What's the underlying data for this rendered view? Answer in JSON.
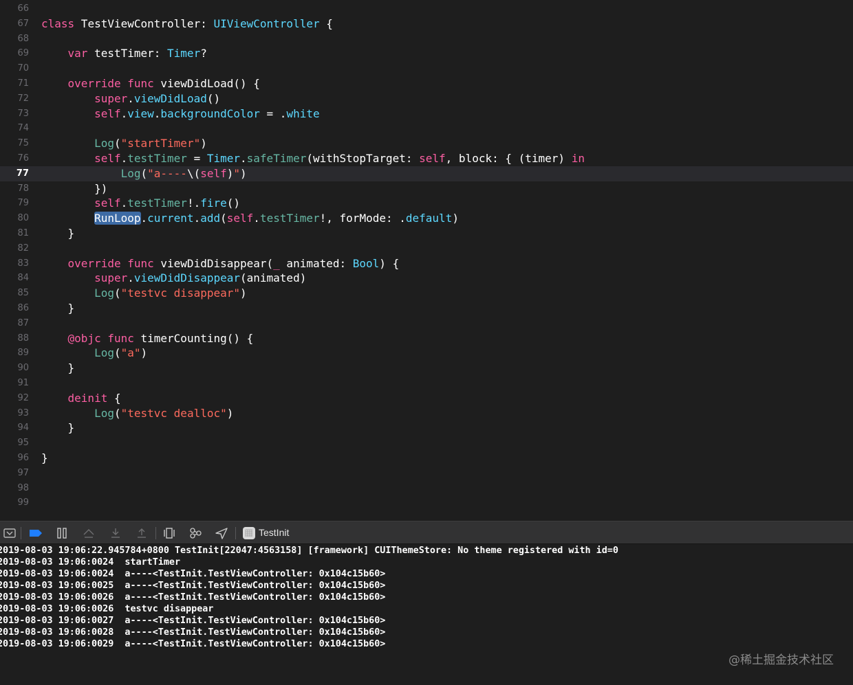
{
  "colors": {
    "keyword": "#fc5fa3",
    "type": "#5dd8ff",
    "function": "#67b7a4",
    "string": "#fc6a5d",
    "plain": "#ffffff",
    "selection": "#3d6ba5",
    "editor_bg": "#1e1e1e",
    "line_number": "#6b6b70",
    "debug_bar_bg": "#323233"
  },
  "editor": {
    "current_line": "77",
    "lines": [
      {
        "n": "66",
        "tokens": []
      },
      {
        "n": "67",
        "tokens": [
          [
            "kw",
            "class"
          ],
          [
            "p",
            " TestViewController: "
          ],
          [
            "type",
            "UIViewController"
          ],
          [
            "p",
            " {"
          ]
        ]
      },
      {
        "n": "68",
        "tokens": []
      },
      {
        "n": "69",
        "tokens": [
          [
            "p",
            "    "
          ],
          [
            "kw",
            "var"
          ],
          [
            "p",
            " testTimer: "
          ],
          [
            "type",
            "Timer"
          ],
          [
            "p",
            "?"
          ]
        ]
      },
      {
        "n": "70",
        "tokens": []
      },
      {
        "n": "71",
        "tokens": [
          [
            "p",
            "    "
          ],
          [
            "kw",
            "override"
          ],
          [
            "p",
            " "
          ],
          [
            "kw",
            "func"
          ],
          [
            "p",
            " viewDidLoad() {"
          ]
        ]
      },
      {
        "n": "72",
        "tokens": [
          [
            "p",
            "        "
          ],
          [
            "kw",
            "super"
          ],
          [
            "p",
            "."
          ],
          [
            "type",
            "viewDidLoad"
          ],
          [
            "p",
            "()"
          ]
        ]
      },
      {
        "n": "73",
        "tokens": [
          [
            "p",
            "        "
          ],
          [
            "kw",
            "self"
          ],
          [
            "p",
            "."
          ],
          [
            "type",
            "view"
          ],
          [
            "p",
            "."
          ],
          [
            "type",
            "backgroundColor"
          ],
          [
            "p",
            " = ."
          ],
          [
            "type",
            "white"
          ]
        ]
      },
      {
        "n": "74",
        "tokens": []
      },
      {
        "n": "75",
        "tokens": [
          [
            "p",
            "        "
          ],
          [
            "fn",
            "Log"
          ],
          [
            "p",
            "("
          ],
          [
            "str",
            "\"startTimer\""
          ],
          [
            "p",
            ")"
          ]
        ]
      },
      {
        "n": "76",
        "tokens": [
          [
            "p",
            "        "
          ],
          [
            "kw",
            "self"
          ],
          [
            "p",
            "."
          ],
          [
            "fn",
            "testTimer"
          ],
          [
            "p",
            " = "
          ],
          [
            "type",
            "Timer"
          ],
          [
            "p",
            "."
          ],
          [
            "fn",
            "safeTimer"
          ],
          [
            "p",
            "(withStopTarget: "
          ],
          [
            "kw",
            "self"
          ],
          [
            "p",
            ", block: { (timer) "
          ],
          [
            "kw",
            "in"
          ]
        ]
      },
      {
        "n": "77",
        "tokens": [
          [
            "p",
            "            "
          ],
          [
            "fn",
            "Log"
          ],
          [
            "p",
            "("
          ],
          [
            "str",
            "\"a----"
          ],
          [
            "p",
            "\\("
          ],
          [
            "kw",
            "self"
          ],
          [
            "p",
            ")"
          ],
          [
            "str",
            "\""
          ],
          [
            "p",
            ")"
          ]
        ]
      },
      {
        "n": "78",
        "tokens": [
          [
            "p",
            "        })"
          ]
        ]
      },
      {
        "n": "79",
        "tokens": [
          [
            "p",
            "        "
          ],
          [
            "kw",
            "self"
          ],
          [
            "p",
            "."
          ],
          [
            "fn",
            "testTimer"
          ],
          [
            "p",
            "!."
          ],
          [
            "type",
            "fire"
          ],
          [
            "p",
            "()"
          ]
        ]
      },
      {
        "n": "80",
        "tokens": [
          [
            "p",
            "        "
          ],
          [
            "sel",
            "RunLoop"
          ],
          [
            "p",
            "."
          ],
          [
            "type",
            "current"
          ],
          [
            "p",
            "."
          ],
          [
            "type",
            "add"
          ],
          [
            "p",
            "("
          ],
          [
            "kw",
            "self"
          ],
          [
            "p",
            "."
          ],
          [
            "fn",
            "testTimer"
          ],
          [
            "p",
            "!, forMode: ."
          ],
          [
            "type",
            "default"
          ],
          [
            "p",
            ")"
          ]
        ]
      },
      {
        "n": "81",
        "tokens": [
          [
            "p",
            "    }"
          ]
        ]
      },
      {
        "n": "82",
        "tokens": []
      },
      {
        "n": "83",
        "tokens": [
          [
            "p",
            "    "
          ],
          [
            "kw",
            "override"
          ],
          [
            "p",
            " "
          ],
          [
            "kw",
            "func"
          ],
          [
            "p",
            " viewDidDisappear("
          ],
          [
            "kw",
            "_"
          ],
          [
            "p",
            " animated: "
          ],
          [
            "type",
            "Bool"
          ],
          [
            "p",
            ") {"
          ]
        ]
      },
      {
        "n": "84",
        "tokens": [
          [
            "p",
            "        "
          ],
          [
            "kw",
            "super"
          ],
          [
            "p",
            "."
          ],
          [
            "type",
            "viewDidDisappear"
          ],
          [
            "p",
            "(animated)"
          ]
        ]
      },
      {
        "n": "85",
        "tokens": [
          [
            "p",
            "        "
          ],
          [
            "fn",
            "Log"
          ],
          [
            "p",
            "("
          ],
          [
            "str",
            "\"testvc disappear\""
          ],
          [
            "p",
            ")"
          ]
        ]
      },
      {
        "n": "86",
        "tokens": [
          [
            "p",
            "    }"
          ]
        ]
      },
      {
        "n": "87",
        "tokens": []
      },
      {
        "n": "88",
        "tokens": [
          [
            "p",
            "    "
          ],
          [
            "kw",
            "@objc"
          ],
          [
            "p",
            " "
          ],
          [
            "kw",
            "func"
          ],
          [
            "p",
            " timerCounting() {"
          ]
        ]
      },
      {
        "n": "89",
        "tokens": [
          [
            "p",
            "        "
          ],
          [
            "fn",
            "Log"
          ],
          [
            "p",
            "("
          ],
          [
            "str",
            "\"a\""
          ],
          [
            "p",
            ")"
          ]
        ]
      },
      {
        "n": "90",
        "tokens": [
          [
            "p",
            "    }"
          ]
        ]
      },
      {
        "n": "91",
        "tokens": []
      },
      {
        "n": "92",
        "tokens": [
          [
            "p",
            "    "
          ],
          [
            "kw",
            "deinit"
          ],
          [
            "p",
            " {"
          ]
        ]
      },
      {
        "n": "93",
        "tokens": [
          [
            "p",
            "        "
          ],
          [
            "fn",
            "Log"
          ],
          [
            "p",
            "("
          ],
          [
            "str",
            "\"testvc dealloc\""
          ],
          [
            "p",
            ")"
          ]
        ]
      },
      {
        "n": "94",
        "tokens": [
          [
            "p",
            "    }"
          ]
        ]
      },
      {
        "n": "95",
        "tokens": []
      },
      {
        "n": "96",
        "tokens": [
          [
            "p",
            "}"
          ]
        ]
      },
      {
        "n": "97",
        "tokens": []
      },
      {
        "n": "98",
        "tokens": []
      },
      {
        "n": "99",
        "tokens": []
      }
    ]
  },
  "debug_bar": {
    "buttons": [
      {
        "name": "hide-console-button",
        "icon": "console-toggle-icon"
      },
      {
        "name": "breakpoints-toggle-button",
        "icon": "breakpoint-icon"
      },
      {
        "name": "pause-button",
        "icon": "pause-icon"
      },
      {
        "name": "step-over-button",
        "icon": "step-over-icon"
      },
      {
        "name": "step-into-button",
        "icon": "step-into-icon"
      },
      {
        "name": "step-out-button",
        "icon": "step-out-icon"
      },
      {
        "name": "view-debugger-button",
        "icon": "view-hierarchy-icon"
      },
      {
        "name": "memory-graph-button",
        "icon": "memory-graph-icon"
      },
      {
        "name": "simulate-location-button",
        "icon": "location-arrow-icon"
      }
    ],
    "target_name": "TestInit"
  },
  "console": {
    "lines": [
      "2019-08-03 19:06:22.945784+0800 TestInit[22047:4563158] [framework] CUIThemeStore: No theme registered with id=0",
      "2019-08-03 19:06:0024  startTimer",
      "2019-08-03 19:06:0024  a----<TestInit.TestViewController: 0x104c15b60>",
      "2019-08-03 19:06:0025  a----<TestInit.TestViewController: 0x104c15b60>",
      "2019-08-03 19:06:0026  a----<TestInit.TestViewController: 0x104c15b60>",
      "2019-08-03 19:06:0026  testvc disappear",
      "2019-08-03 19:06:0027  a----<TestInit.TestViewController: 0x104c15b60>",
      "2019-08-03 19:06:0028  a----<TestInit.TestViewController: 0x104c15b60>",
      "2019-08-03 19:06:0029  a----<TestInit.TestViewController: 0x104c15b60>"
    ]
  },
  "watermark": "@稀土掘金技术社区"
}
